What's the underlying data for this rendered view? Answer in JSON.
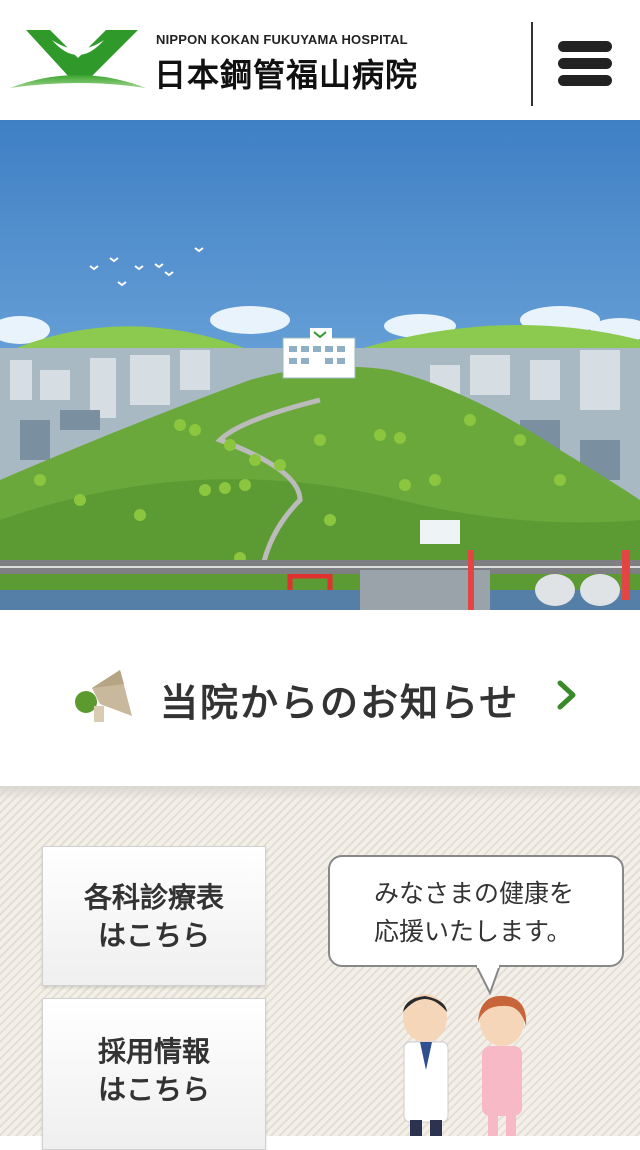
{
  "header": {
    "hospital_name_en": "NIPPON KOKAN FUKUYAMA HOSPITAL",
    "hospital_name_jp": "日本鋼管福山病院",
    "logo_icon": "hospital-logo-mark",
    "menu_icon": "hamburger-menu-icon"
  },
  "hero": {
    "illustration": "city-and-hill-illustration"
  },
  "news": {
    "label": "当院からのお知らせ",
    "icon": "megaphone-icon",
    "chevron": "chevron-right-icon"
  },
  "links": {
    "schedule_line1": "各科診療表",
    "schedule_line2": "はこちら",
    "recruit_line1": "採用情報",
    "recruit_line2": "はこちら"
  },
  "bubble": {
    "line1": "みなさまの健康を",
    "line2": "応援いたします。"
  },
  "colors": {
    "brand_green": "#3a9b2a",
    "accent_green": "#6cb33f",
    "sky": "#4a86c8"
  }
}
